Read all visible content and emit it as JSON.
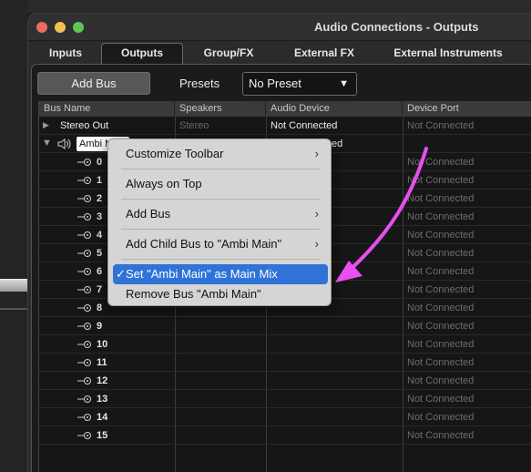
{
  "window": {
    "title": "Audio Connections - Outputs"
  },
  "tabs": [
    {
      "label": "Inputs"
    },
    {
      "label": "Outputs"
    },
    {
      "label": "Group/FX"
    },
    {
      "label": "External FX"
    },
    {
      "label": "External Instruments"
    }
  ],
  "toolbar": {
    "add_bus_label": "Add Bus",
    "presets_label": "Presets",
    "preset_value": "No Preset",
    "preset_arrow": "▼"
  },
  "columns": {
    "bus_name": "Bus Name",
    "speakers": "Speakers",
    "audio_device": "Audio Device",
    "device_port": "Device Port"
  },
  "stereo_out": {
    "name": "Stereo Out",
    "speakers": "Stereo",
    "audio_device": "Not Connected",
    "device_port": "Not Connected"
  },
  "ambi_main": {
    "name": "Ambi M",
    "audio_device_partial": "ed"
  },
  "not_connected": "Not Connected",
  "channels": [
    "0",
    "1",
    "2",
    "3",
    "4",
    "5",
    "6",
    "7",
    "8",
    "9",
    "10",
    "11",
    "12",
    "13",
    "14",
    "15"
  ],
  "context_menu": {
    "items": [
      {
        "label": "Customize Toolbar",
        "submenu": "›"
      },
      {
        "label": "Always on Top"
      },
      {
        "label": "Add Bus",
        "submenu": "›"
      },
      {
        "label": "Add Child Bus to \"Ambi Main\"",
        "submenu": "›"
      },
      {
        "label": "Set \"Ambi Main\" as Main Mix",
        "checked": "✓"
      },
      {
        "label": "Remove Bus \"Ambi Main\""
      }
    ]
  },
  "colors": {
    "highlight": "#2f73d8",
    "annotation_arrow": "#e84ff0"
  }
}
